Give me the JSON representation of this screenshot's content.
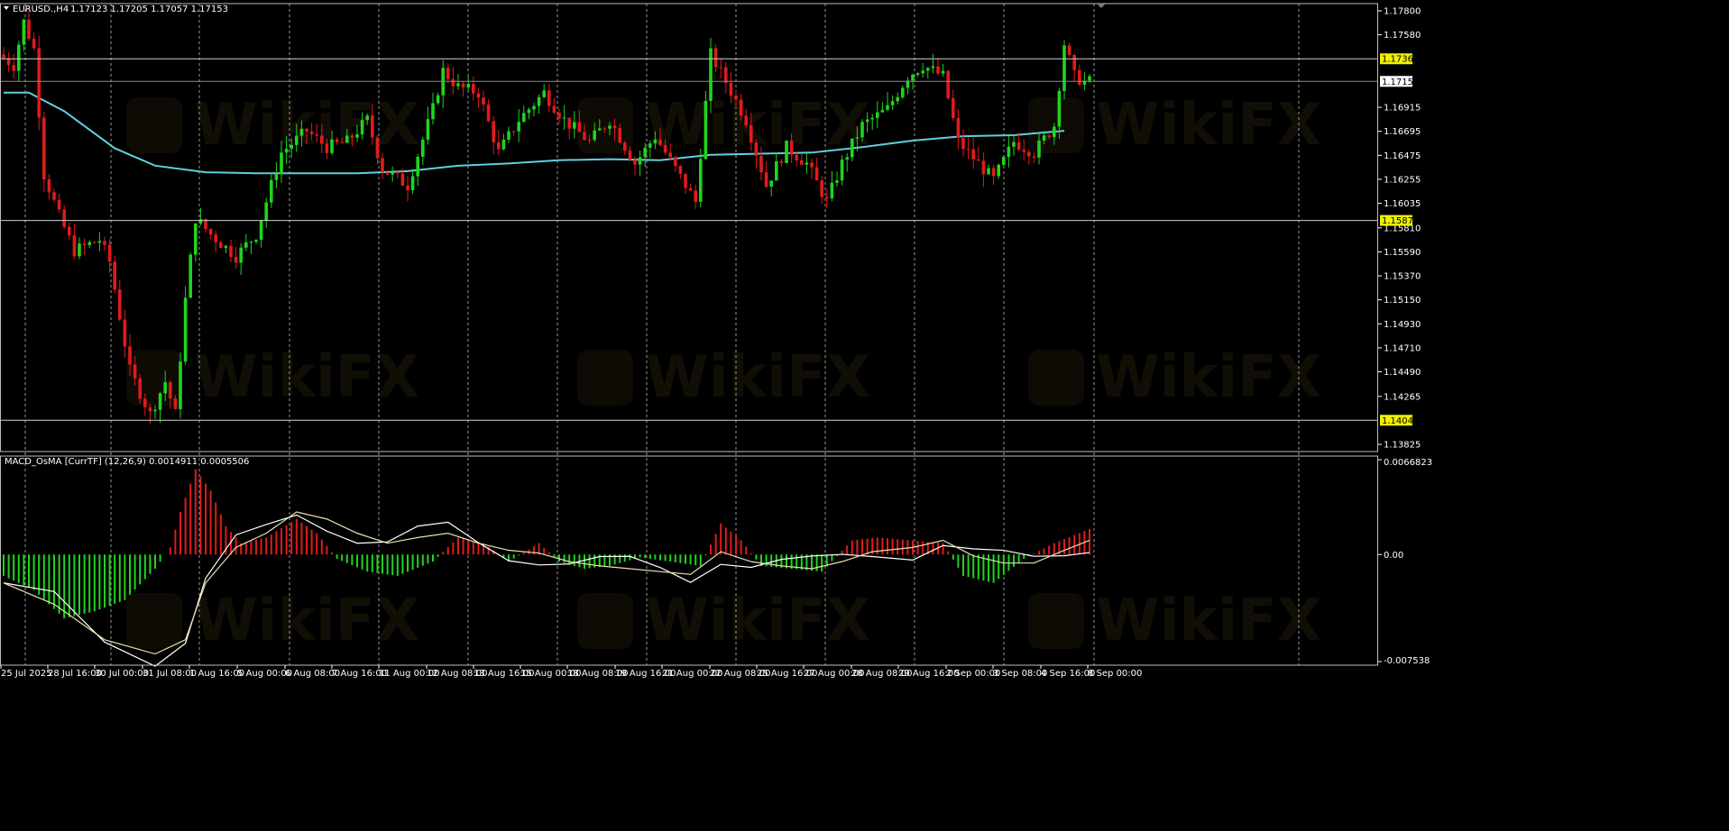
{
  "header": {
    "symbol": "EURUSD.,H4",
    "ohlc": "1.17123 1.17205 1.17057 1.17153",
    "indicator": "MACD_OsMA [CurrTF] (12,26,9) 0.0014911 0.0005506"
  },
  "watermark": "WikiFX",
  "colors": {
    "background": "#000000",
    "bull": "#1fd41f",
    "bear": "#e01b1b",
    "ma": "#5fd0e0",
    "grid": "#d8d8d8",
    "hline": "#cfcfcf",
    "hline_label_bg": "#f0f000",
    "price_label_bg": "#ffffff"
  },
  "price_axis": {
    "labels": [
      "1.17800",
      "1.17580",
      "1.16915",
      "1.16695",
      "1.16475",
      "1.16255",
      "1.16035",
      "1.15810",
      "1.15590",
      "1.15370",
      "1.15150",
      "1.14930",
      "1.14710",
      "1.14490",
      "1.14265",
      "1.13825"
    ],
    "hlines": [
      "1.17360",
      "1.15878",
      "1.14046"
    ],
    "current_price": "1.17153"
  },
  "indicator_axis": {
    "top": "0.0066823",
    "zero": "0.00",
    "bottom": "-0.007538"
  },
  "time_axis": [
    "25 Jul 2025",
    "28 Jul 16:00",
    "30 Jul 00:00",
    "31 Jul 08:00",
    "1 Aug 16:00",
    "5 Aug 00:00",
    "6 Aug 08:00",
    "7 Aug 16:00",
    "11 Aug 00:00",
    "12 Aug 08:00",
    "13 Aug 16:00",
    "15 Aug 00:00",
    "18 Aug 08:00",
    "19 Aug 16:00",
    "21 Aug 00:00",
    "22 Aug 08:00",
    "25 Aug 16:00",
    "27 Aug 00:00",
    "28 Aug 08:00",
    "29 Aug 16:00",
    "2 Sep 00:00",
    "3 Sep 08:00",
    "4 Sep 16:00",
    "8 Sep 00:00"
  ],
  "chart_data": {
    "type": "candlestick",
    "symbol": "EURUSD",
    "timeframe": "H4",
    "price_range": [
      1.1378,
      1.1786
    ],
    "moving_average": {
      "anchors": [
        [
          0,
          1.1705
        ],
        [
          5,
          1.1705
        ],
        [
          12,
          1.1688
        ],
        [
          22,
          1.1654
        ],
        [
          30,
          1.1638
        ],
        [
          40,
          1.1632
        ],
        [
          50,
          1.1631
        ],
        [
          60,
          1.1631
        ],
        [
          70,
          1.1631
        ],
        [
          80,
          1.1633
        ],
        [
          90,
          1.1638
        ],
        [
          100,
          1.164
        ],
        [
          110,
          1.1643
        ],
        [
          120,
          1.1644
        ],
        [
          130,
          1.1643
        ],
        [
          140,
          1.1648
        ],
        [
          150,
          1.1649
        ],
        [
          160,
          1.165
        ],
        [
          170,
          1.1655
        ],
        [
          180,
          1.1661
        ],
        [
          190,
          1.1665
        ],
        [
          200,
          1.1666
        ],
        [
          210,
          1.167
        ]
      ]
    },
    "price_keypoints": [
      [
        0,
        1.174
      ],
      [
        3,
        1.173
      ],
      [
        5,
        1.177
      ],
      [
        7,
        1.1745
      ],
      [
        9,
        1.163
      ],
      [
        12,
        1.1592
      ],
      [
        15,
        1.156
      ],
      [
        20,
        1.157
      ],
      [
        22,
        1.155
      ],
      [
        26,
        1.145
      ],
      [
        30,
        1.141
      ],
      [
        33,
        1.144
      ],
      [
        35,
        1.141
      ],
      [
        37,
        1.1515
      ],
      [
        39,
        1.159
      ],
      [
        42,
        1.1575
      ],
      [
        47,
        1.1555
      ],
      [
        51,
        1.1575
      ],
      [
        56,
        1.165
      ],
      [
        61,
        1.167
      ],
      [
        65,
        1.1655
      ],
      [
        69,
        1.166
      ],
      [
        73,
        1.168
      ],
      [
        76,
        1.1635
      ],
      [
        81,
        1.162
      ],
      [
        86,
        1.169
      ],
      [
        88,
        1.1725
      ],
      [
        91,
        1.171
      ],
      [
        95,
        1.1705
      ],
      [
        99,
        1.165
      ],
      [
        103,
        1.168
      ],
      [
        108,
        1.1705
      ],
      [
        112,
        1.168
      ],
      [
        117,
        1.166
      ],
      [
        121,
        1.168
      ],
      [
        126,
        1.164
      ],
      [
        130,
        1.1665
      ],
      [
        134,
        1.1635
      ],
      [
        138,
        1.1605
      ],
      [
        141,
        1.174
      ],
      [
        144,
        1.1715
      ],
      [
        148,
        1.168
      ],
      [
        152,
        1.162
      ],
      [
        156,
        1.1655
      ],
      [
        160,
        1.164
      ],
      [
        164,
        1.1605
      ],
      [
        167,
        1.164
      ],
      [
        171,
        1.1675
      ],
      [
        176,
        1.169
      ],
      [
        180,
        1.172
      ],
      [
        183,
        1.173
      ],
      [
        187,
        1.172
      ],
      [
        190,
        1.166
      ],
      [
        194,
        1.164
      ],
      [
        197,
        1.1625
      ],
      [
        201,
        1.166
      ],
      [
        205,
        1.165
      ],
      [
        209,
        1.1675
      ],
      [
        211,
        1.175
      ],
      [
        213,
        1.172
      ],
      [
        215,
        1.1715
      ]
    ],
    "candle_count": 216,
    "macd_keypoints": [
      [
        0,
        -0.0015
      ],
      [
        6,
        -0.0025
      ],
      [
        12,
        -0.0045
      ],
      [
        18,
        -0.004
      ],
      [
        24,
        -0.0032
      ],
      [
        30,
        -0.001
      ],
      [
        33,
        0.0005
      ],
      [
        35,
        0.003
      ],
      [
        38,
        0.006
      ],
      [
        41,
        0.0045
      ],
      [
        44,
        0.002
      ],
      [
        47,
        0.0008
      ],
      [
        52,
        0.0012
      ],
      [
        58,
        0.0025
      ],
      [
        62,
        0.0015
      ],
      [
        66,
        -0.0003
      ],
      [
        72,
        -0.0012
      ],
      [
        78,
        -0.0015
      ],
      [
        85,
        -0.0005
      ],
      [
        90,
        0.0012
      ],
      [
        95,
        0.0008
      ],
      [
        100,
        -0.0005
      ],
      [
        106,
        0.0008
      ],
      [
        110,
        -0.0005
      ],
      [
        115,
        -0.001
      ],
      [
        120,
        -0.0008
      ],
      [
        126,
        -0.0002
      ],
      [
        132,
        -0.0005
      ],
      [
        138,
        -0.0008
      ],
      [
        142,
        0.0022
      ],
      [
        146,
        0.001
      ],
      [
        150,
        -0.0008
      ],
      [
        156,
        -0.001
      ],
      [
        162,
        -0.0012
      ],
      [
        168,
        0.001
      ],
      [
        173,
        0.0012
      ],
      [
        180,
        0.001
      ],
      [
        186,
        0.0008
      ],
      [
        190,
        -0.0015
      ],
      [
        196,
        -0.002
      ],
      [
        202,
        -0.0003
      ],
      [
        208,
        0.0008
      ],
      [
        215,
        0.0018
      ]
    ],
    "macd_signal_keypoints": [
      [
        0,
        -0.002
      ],
      [
        10,
        -0.0035
      ],
      [
        20,
        -0.006
      ],
      [
        30,
        -0.007
      ],
      [
        36,
        -0.006
      ],
      [
        40,
        -0.002
      ],
      [
        46,
        0.0005
      ],
      [
        52,
        0.0015
      ],
      [
        58,
        0.003
      ],
      [
        64,
        0.0025
      ],
      [
        70,
        0.0015
      ],
      [
        76,
        0.0008
      ],
      [
        82,
        0.0012
      ],
      [
        88,
        0.0015
      ],
      [
        94,
        0.0008
      ],
      [
        100,
        0.0003
      ],
      [
        106,
        0.0001
      ],
      [
        112,
        -0.0005
      ],
      [
        118,
        -0.0008
      ],
      [
        124,
        -0.001
      ],
      [
        130,
        -0.0012
      ],
      [
        136,
        -0.0014
      ],
      [
        142,
        0.0002
      ],
      [
        148,
        -0.0005
      ],
      [
        154,
        -0.0008
      ],
      [
        160,
        -0.001
      ],
      [
        166,
        -0.0005
      ],
      [
        172,
        0.0002
      ],
      [
        180,
        0.0005
      ],
      [
        186,
        0.001
      ],
      [
        192,
        -0.0001
      ],
      [
        198,
        -0.0006
      ],
      [
        204,
        -0.0006
      ],
      [
        210,
        0.0003
      ],
      [
        215,
        0.001
      ]
    ]
  }
}
